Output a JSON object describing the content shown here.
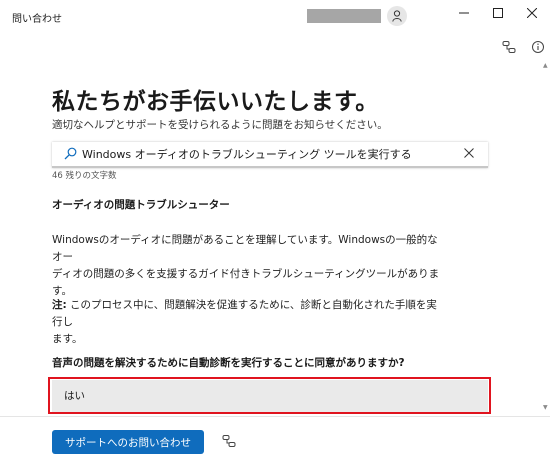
{
  "window": {
    "title": "問い合わせ"
  },
  "main": {
    "heading": "私たちがお手伝いいたします。",
    "subtitle": "適切なヘルプとサポートを受けられるように問題をお知らせください。",
    "search": {
      "value": "Windows オーディオのトラブルシューティング ツールを実行する"
    },
    "char_count": "46 残りの文字数",
    "section_title": "オーディオの問題トラブルシューター",
    "body_lines": [
      "Windowsのオーディオに問題があることを理解しています。Windowsの一般的なオー",
      "ディオの問題の多くを支援するガイド付きトラブルシューティングツールがありま",
      "す。"
    ],
    "note_label": "注:",
    "note_lines": [
      " このプロセス中に、問題解決を促進するために、診断と自動化された手順を実行し",
      "ます。"
    ],
    "question": "音声の問題を解決するために自動診断を実行することに同意がありますか?",
    "answer": "はい"
  },
  "footer": {
    "contact_button": "サポートへのお問い合わせ"
  },
  "colors": {
    "accent": "#0f6cbd",
    "highlight": "#e0141f"
  },
  "icons": [
    "person-icon",
    "minimize-icon",
    "maximize-icon",
    "close-icon",
    "share-icon",
    "info-icon",
    "search-icon",
    "clear-icon"
  ]
}
